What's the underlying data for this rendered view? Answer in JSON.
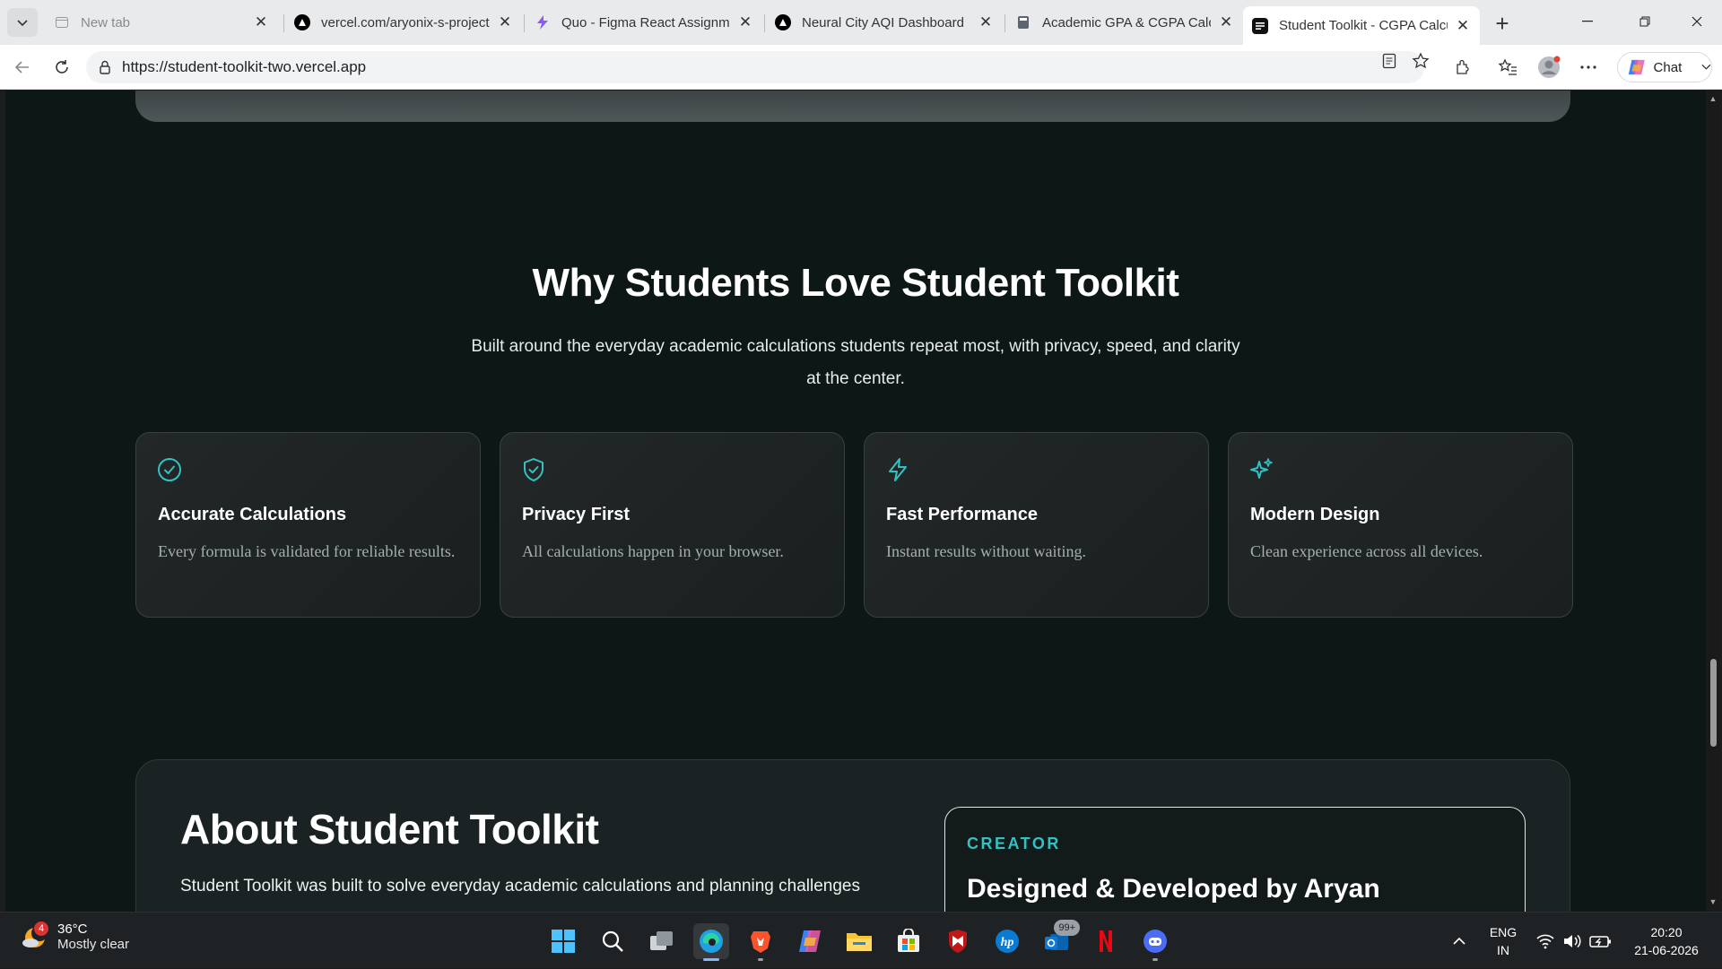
{
  "browser": {
    "tabs": [
      {
        "title": "New tab",
        "faded": true
      },
      {
        "title": "vercel.com/aryonix-s-projects"
      },
      {
        "title": "Quo - Figma React Assignment"
      },
      {
        "title": "Neural City AQI Dashboard"
      },
      {
        "title": "Academic GPA & CGPA Calculator"
      },
      {
        "title": "Student Toolkit - CGPA Calculator",
        "active": true
      }
    ],
    "url": "https://student-toolkit-two.vercel.app",
    "chat_label": "Chat"
  },
  "page": {
    "why": {
      "title": "Why Students Love Student Toolkit",
      "subtitle": "Built around the everyday academic calculations students repeat most, with privacy, speed, and clarity at the center."
    },
    "features": [
      {
        "icon": "check-circle-icon",
        "title": "Accurate Calculations",
        "desc": "Every formula is validated for reliable results."
      },
      {
        "icon": "shield-check-icon",
        "title": "Privacy First",
        "desc": "All calculations happen in your browser."
      },
      {
        "icon": "lightning-icon",
        "title": "Fast Performance",
        "desc": "Instant results without waiting."
      },
      {
        "icon": "sparkles-icon",
        "title": "Modern Design",
        "desc": "Clean experience across all devices."
      }
    ],
    "about": {
      "title": "About Student Toolkit",
      "desc": "Student Toolkit was built to solve everyday academic calculations and planning challenges",
      "creator_label": "CREATOR",
      "creator_name": "Designed & Developed by Aryan"
    },
    "accent_color": "#35c0c4"
  },
  "taskbar": {
    "weather": {
      "badge": "4",
      "temp": "36°C",
      "condition": "Mostly clear"
    },
    "notification_badge": "99+",
    "lang_line1": "ENG",
    "lang_line2": "IN",
    "time": "20:20",
    "date": "21-06-2026"
  }
}
